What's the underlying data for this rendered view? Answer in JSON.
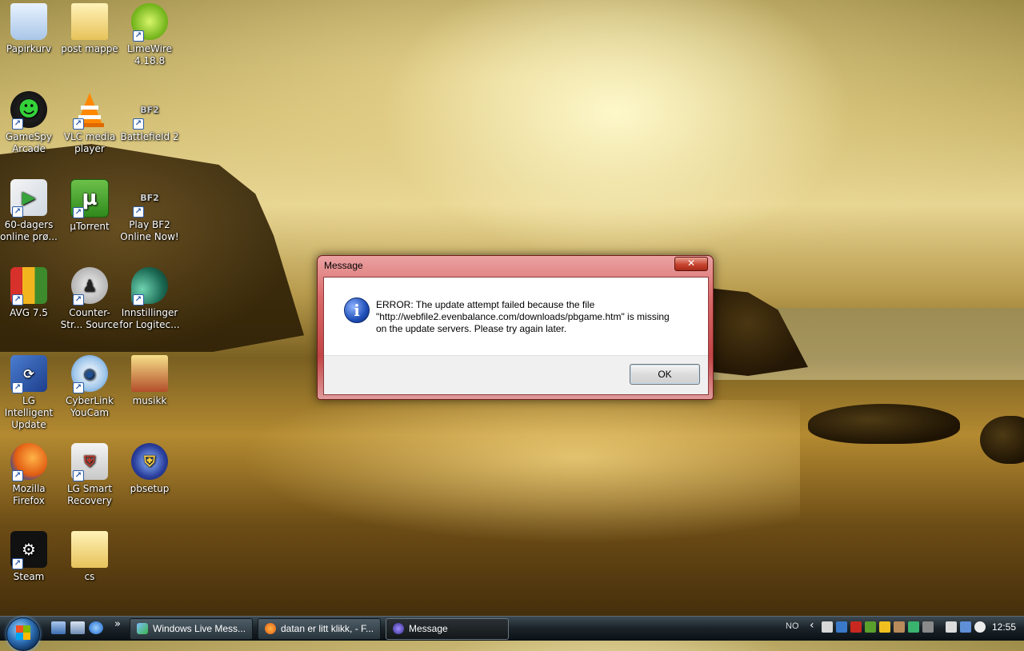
{
  "desktop": {
    "icons": [
      {
        "label": "Papirkurv"
      },
      {
        "label": "post mappe"
      },
      {
        "label": "LimeWire 4.18.8"
      },
      {
        "label": "GameSpy Arcade"
      },
      {
        "label": "VLC media player"
      },
      {
        "label": "Battlefield 2"
      },
      {
        "label": "60-dagers online prø..."
      },
      {
        "label": "µTorrent"
      },
      {
        "label": "Play BF2 Online Now!"
      },
      {
        "label": "AVG 7.5"
      },
      {
        "label": "Counter-Str... Source"
      },
      {
        "label": "Innstillinger for Logitec..."
      },
      {
        "label": "LG Intelligent Update"
      },
      {
        "label": "CyberLink YouCam"
      },
      {
        "label": "musikk"
      },
      {
        "label": "Mozilla Firefox"
      },
      {
        "label": "LG Smart Recovery"
      },
      {
        "label": "pbsetup"
      },
      {
        "label": "Steam"
      },
      {
        "label": "cs"
      }
    ]
  },
  "dialog": {
    "title": "Message",
    "close_label": "✕",
    "line1": "ERROR: The update attempt failed because the file",
    "line2": "\"http://webfile2.evenbalance.com/downloads/pbgame.htm\" is missing",
    "line3": "on the update servers.  Please try again later.",
    "ok_label": "OK"
  },
  "taskbar": {
    "quicklaunch_more": "»",
    "tasks": [
      {
        "label": "Windows Live Mess..."
      },
      {
        "label": "datan er litt klikk, - F..."
      },
      {
        "label": "Message"
      }
    ],
    "language": "NO",
    "tray_arrow": "‹",
    "clock": "12:55"
  }
}
